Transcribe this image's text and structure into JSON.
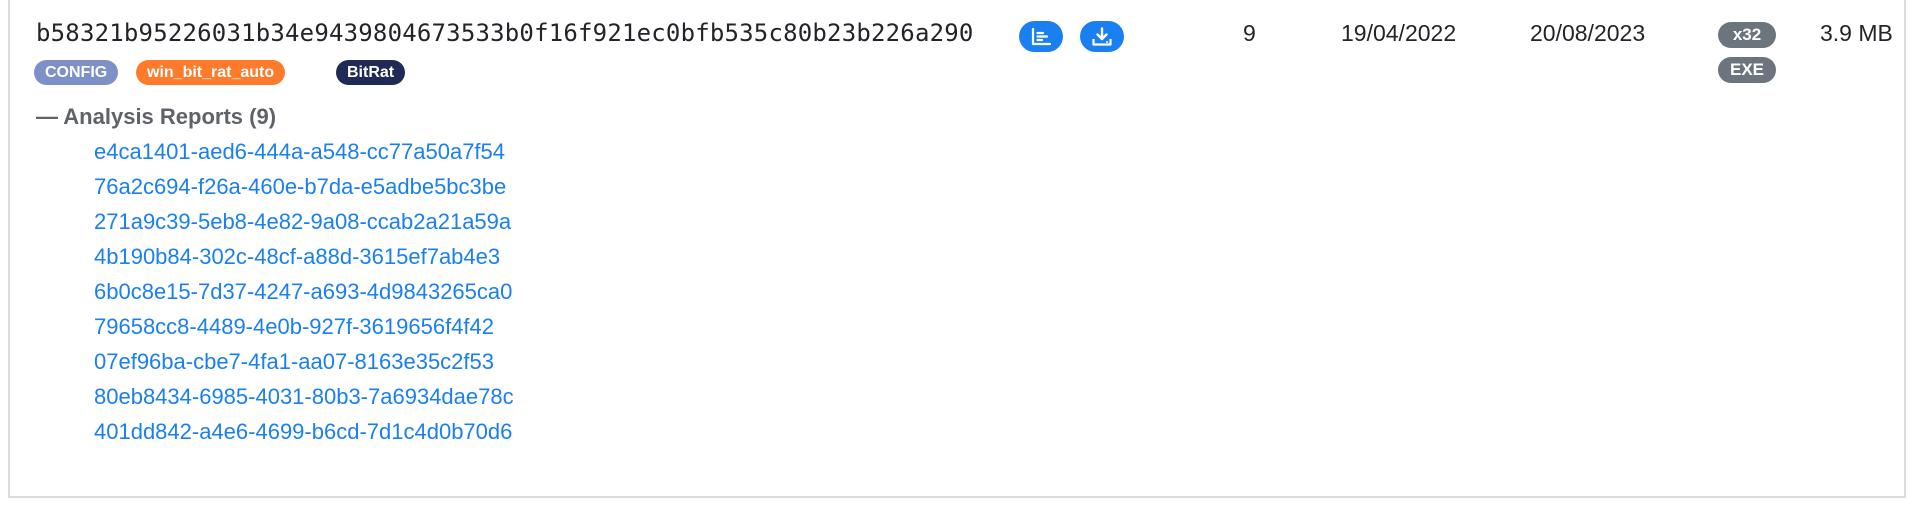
{
  "sample": {
    "sha256": "b58321b95226031b34e9439804673533b0f16f921ec0bfb535c80b23b226a290",
    "tags": [
      {
        "label": "CONFIG",
        "color": "#7d90c8"
      },
      {
        "label": "win_bit_rat_auto",
        "color": "#fd7b2b"
      },
      {
        "label": "BitRat",
        "color": "#202a57"
      }
    ],
    "icons": {
      "report": "report-list-icon",
      "download": "download-icon"
    },
    "report_count": "9",
    "first_seen": "19/04/2022",
    "last_seen": "20/08/2023",
    "arch": "x32",
    "file_type": "EXE",
    "size": "3.9 MB"
  },
  "analysis_reports": {
    "toggle_symbol": "—",
    "title": "Analysis Reports (9)",
    "items": [
      "e4ca1401-aed6-444a-a548-cc77a50a7f54",
      "76a2c694-f26a-460e-b7da-e5adbe5bc3be",
      "271a9c39-5eb8-4e82-9a08-ccab2a21a59a",
      "4b190b84-302c-48cf-a88d-3615ef7ab4e3",
      "6b0c8e15-7d37-4247-a693-4d9843265ca0",
      "79658cc8-4489-4e0b-927f-3619656f4f42",
      "07ef96ba-cbe7-4fa1-aa07-8163e35c2f53",
      "80eb8434-6985-4031-80b3-7a6934dae78c",
      "401dd842-a4e6-4699-b6cd-7d1c4d0b70d6"
    ]
  },
  "colors": {
    "link": "#1a7ff0",
    "button": "#1a7ff0",
    "badge_gray": "#6c757d"
  }
}
